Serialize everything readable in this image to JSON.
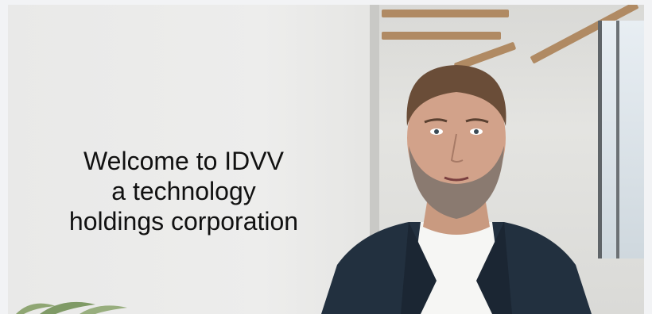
{
  "video": {
    "caption_lines": [
      "Welcome to IDVV",
      "a technology",
      "holdings corporation"
    ]
  }
}
